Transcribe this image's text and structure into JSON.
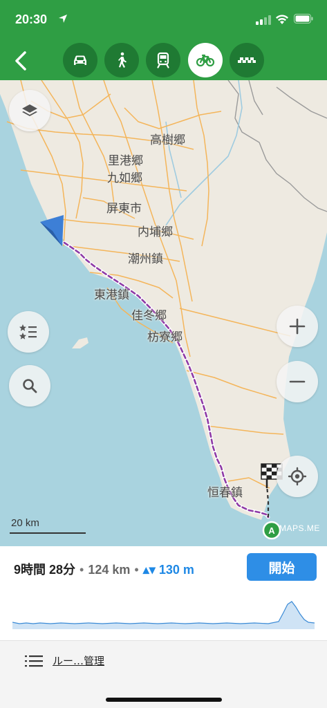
{
  "status": {
    "time": "20:30"
  },
  "topbar": {
    "modes": [
      {
        "name": "car",
        "icon": "car-icon"
      },
      {
        "name": "pedestrian",
        "icon": "walk-icon"
      },
      {
        "name": "transit",
        "icon": "train-icon"
      },
      {
        "name": "bicycle",
        "icon": "bicycle-icon",
        "active": true
      },
      {
        "name": "taxi",
        "icon": "taxi-icon"
      }
    ]
  },
  "map": {
    "labels": {
      "gaoshu": "高樹郷",
      "ligang": "里港郷",
      "jiuru": "九如郷",
      "pingtung": "屏東市",
      "neipu": "内埔郷",
      "chaozhou": "潮州鎮",
      "donggang": "東港鎮",
      "jiadong": "佳冬郷",
      "fangliao": "枋寮郷",
      "hengchun": "恒春鎮"
    },
    "scale_label": "20 km",
    "attribution": "MAPS.ME",
    "colors": {
      "sea": "#a9d3df",
      "land": "#eeeae1",
      "road": "#f4b55a",
      "route": "#8e3aa6"
    }
  },
  "route": {
    "time": "9時間 28分",
    "distance": "124 km",
    "elevation": "130 m",
    "start_label": "開始"
  },
  "bottom": {
    "manage_label": "ルー…管理"
  }
}
